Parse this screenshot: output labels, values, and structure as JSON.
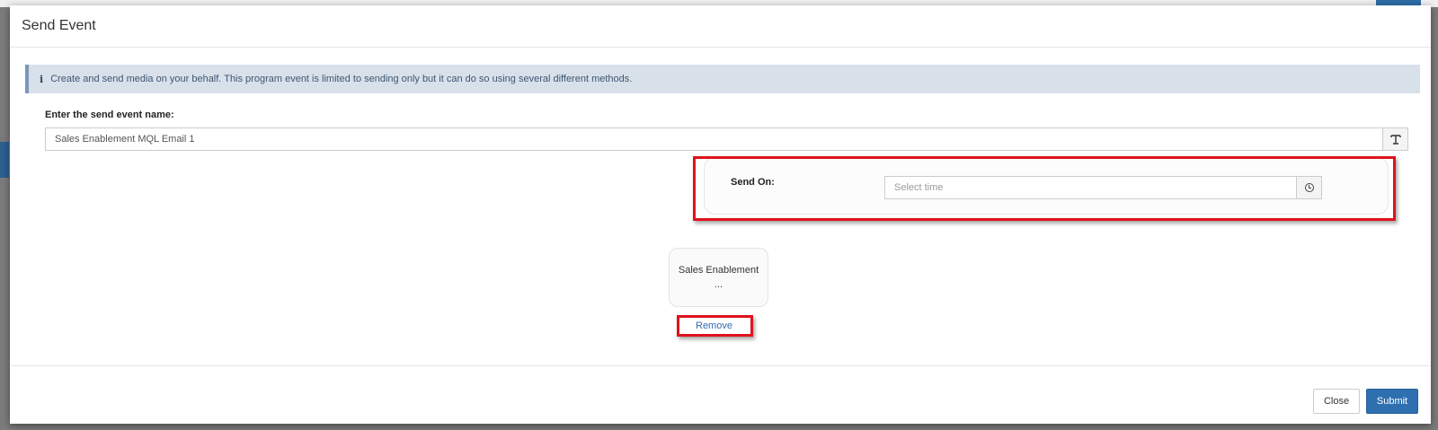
{
  "modal": {
    "title": "Send Event"
  },
  "info": {
    "icon": "info-icon",
    "text": "Create and send media on your behalf. This program event is limited to sending only but it can do so using several different methods."
  },
  "event_name": {
    "label": "Enter the send event name:",
    "value": "Sales Enablement MQL Email 1",
    "addon_icon": "text-format-icon",
    "addon_glyph": "T"
  },
  "send_on": {
    "label": "Send On:",
    "placeholder": "Select time",
    "icon": "clock-icon"
  },
  "media_card": {
    "text": "Sales Enablement ..."
  },
  "remove_link": {
    "label": "Remove"
  },
  "footer": {
    "close_label": "Close",
    "submit_label": "Submit"
  },
  "colors": {
    "highlight": "#e0121c",
    "primary": "#2e6fb0",
    "banner_bg": "#d8e0ea"
  }
}
